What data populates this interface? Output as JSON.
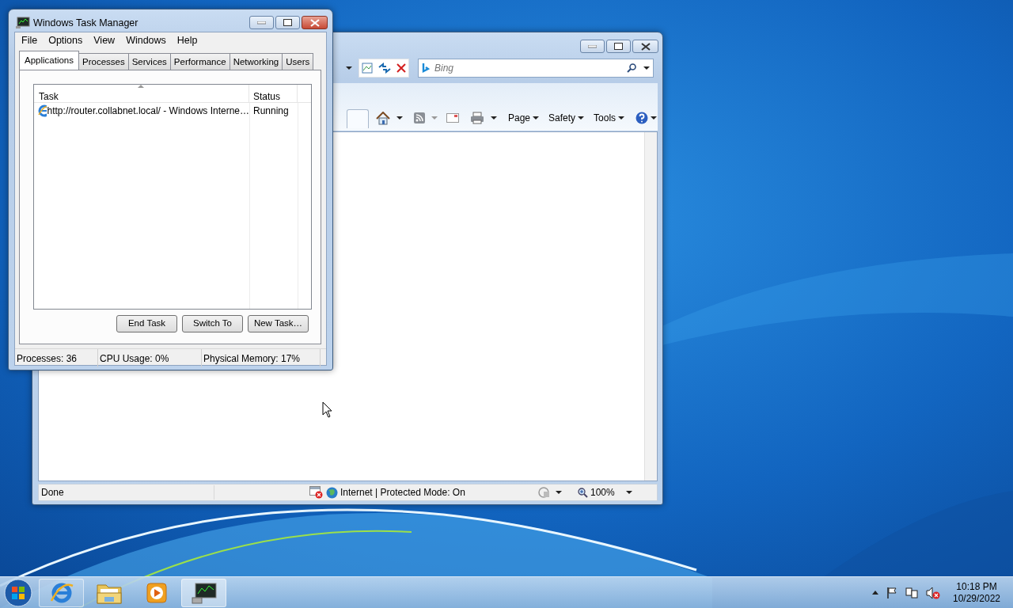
{
  "browser": {
    "search": {
      "placeholder": "Bing"
    },
    "command_bar": [
      {
        "label": "Page"
      },
      {
        "label": "Safety"
      },
      {
        "label": "Tools"
      }
    ],
    "status_bar": {
      "status": "Done",
      "zone": "Internet | Protected Mode: On",
      "zoom": "100%"
    }
  },
  "task_manager": {
    "title": "Windows Task Manager",
    "menu": [
      "File",
      "Options",
      "View",
      "Windows",
      "Help"
    ],
    "tabs": [
      {
        "label": "Applications",
        "selected": true
      },
      {
        "label": "Processes",
        "selected": false
      },
      {
        "label": "Services",
        "selected": false
      },
      {
        "label": "Performance",
        "selected": false
      },
      {
        "label": "Networking",
        "selected": false
      },
      {
        "label": "Users",
        "selected": false
      }
    ],
    "columns": [
      "Task",
      "Status"
    ],
    "tasks": [
      {
        "task": "http://router.collabnet.local/ - Windows Interne…",
        "status": "Running"
      }
    ],
    "buttons": [
      "End Task",
      "Switch To",
      "New Task…"
    ],
    "status_bar": [
      "Processes: 36",
      "CPU Usage: 0%",
      "Physical Memory: 17%"
    ]
  },
  "taskbar": {
    "buttons": [
      {
        "kind": "browser",
        "running": true,
        "selected": false
      },
      {
        "kind": "folder",
        "running": false,
        "selected": false
      },
      {
        "kind": "media",
        "running": false,
        "selected": false
      },
      {
        "kind": "monitor",
        "running": true,
        "selected": true
      }
    ],
    "time": "10:18 PM",
    "date": "10/29/2022"
  }
}
